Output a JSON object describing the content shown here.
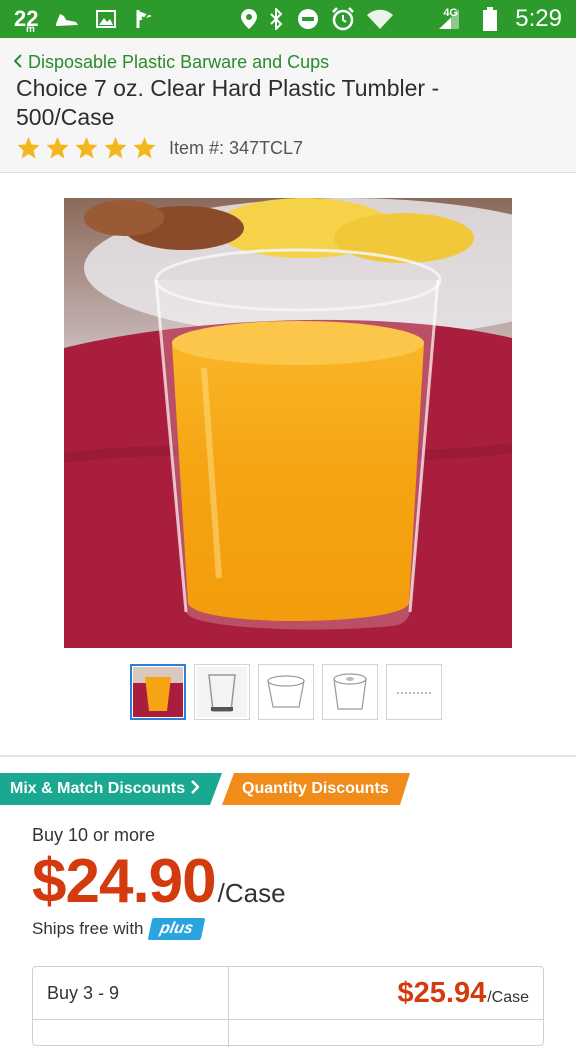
{
  "status_bar": {
    "temperature": "22",
    "temperature_sub": "m",
    "network": "4G",
    "time": "5:29",
    "icons": [
      "shoe-icon",
      "image-icon",
      "check-flag-icon",
      "location-icon",
      "bluetooth-icon",
      "dnd-icon",
      "alarm-icon",
      "wifi-icon",
      "signal-icon",
      "battery-icon"
    ]
  },
  "header": {
    "breadcrumb": "Disposable Plastic Barware and Cups",
    "title": "Choice 7 oz. Clear Hard Plastic Tumbler - 500/Case",
    "rating": 5,
    "item_number": "Item #: 347TCL7"
  },
  "gallery": {
    "thumbnail_count": 5,
    "active_index": 0
  },
  "tabs": {
    "mix_match": "Mix & Match Discounts",
    "quantity": "Quantity Discounts"
  },
  "pricing": {
    "buy_label": "Buy 10 or more",
    "price": "$24.90",
    "unit": "/Case",
    "ships_free": "Ships free with",
    "plus_badge": "plus",
    "tiers": [
      {
        "qty": "Buy 3 - 9",
        "price": "$25.94",
        "unit": "/Case"
      }
    ]
  },
  "colors": {
    "status_green": "#2c9b2c",
    "link_green": "#2c8b2c",
    "price_red": "#d33a0d",
    "teal": "#1aa890",
    "orange": "#f08c1a",
    "star_gold": "#f2b81b",
    "plus_blue": "#2aa4de"
  }
}
